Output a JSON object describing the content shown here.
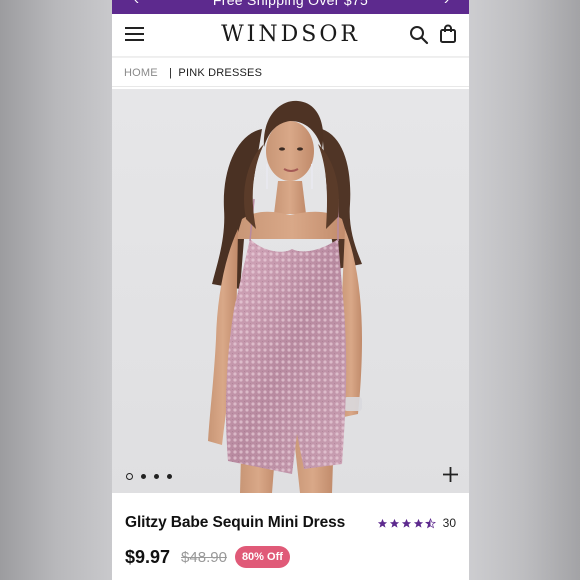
{
  "promo": {
    "text": "Free Shipping Over $75",
    "prev_arrow": "‹",
    "next_arrow": "›"
  },
  "header": {
    "logo": "WINDSOR",
    "icons": [
      "menu-icon",
      "search-icon",
      "shopping-bag-icon"
    ]
  },
  "breadcrumb": {
    "home": "HOME",
    "separator": "|",
    "current": "PINK DRESSES"
  },
  "gallery": {
    "image_count": 4,
    "active_index": 0,
    "icons": [
      "plus-icon"
    ]
  },
  "product": {
    "name": "Glitzy Babe Sequin Mini Dress",
    "rating": 4.5,
    "rating_max": 5,
    "review_count": "30",
    "sale_price": "$9.97",
    "original_price": "$48.90",
    "discount": "80% Off"
  },
  "colors": {
    "brand_purple": "#5d2a8e",
    "star_purple": "#5d2a8e",
    "discount_pink": "#e05a78",
    "dress_pink": "#c79aae"
  }
}
